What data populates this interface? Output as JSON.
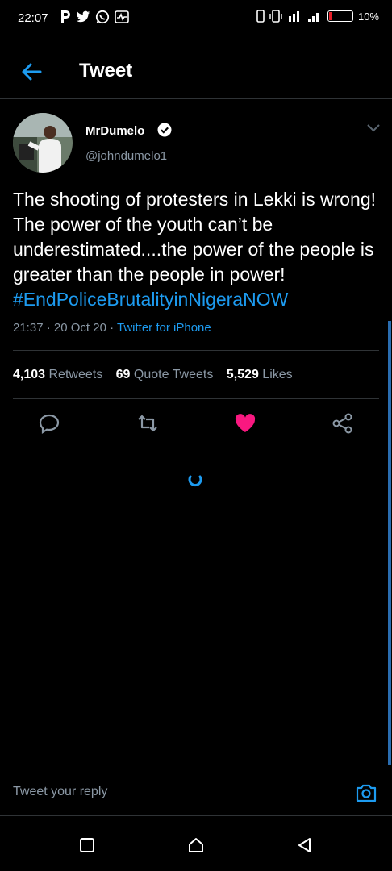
{
  "status_bar": {
    "time": "22:07",
    "battery_percent": "10%",
    "battery_level": 0.1
  },
  "header": {
    "title": "Tweet"
  },
  "tweet": {
    "author_name": "MrDumelo",
    "handle": "@johndumelo1",
    "text": "The shooting of protesters in Lekki  is wrong! The power of the youth can’t be underestimated....the power of the people is greater than the people in power! ",
    "hashtag": "#EndPoliceBrutalityinNigeraNOW",
    "time": "21:37",
    "date": "20 Oct 20",
    "source": "Twitter for iPhone",
    "sep": " · "
  },
  "stats": {
    "retweets_count": "4,103",
    "retweets_label": "Retweets",
    "quotes_count": "69",
    "quotes_label": "Quote Tweets",
    "likes_count": "5,529",
    "likes_label": "Likes"
  },
  "reply": {
    "placeholder": "Tweet your reply"
  },
  "colors": {
    "accent": "#1d9bf0",
    "like": "#f91880",
    "background": "#000000"
  },
  "icons": [
    "back-arrow-icon",
    "verified-icon",
    "chevron-down-icon",
    "reply-icon",
    "retweet-icon",
    "like-icon",
    "share-icon",
    "loading-spinner-icon",
    "camera-icon",
    "recents-icon",
    "home-icon",
    "back-nav-icon"
  ]
}
